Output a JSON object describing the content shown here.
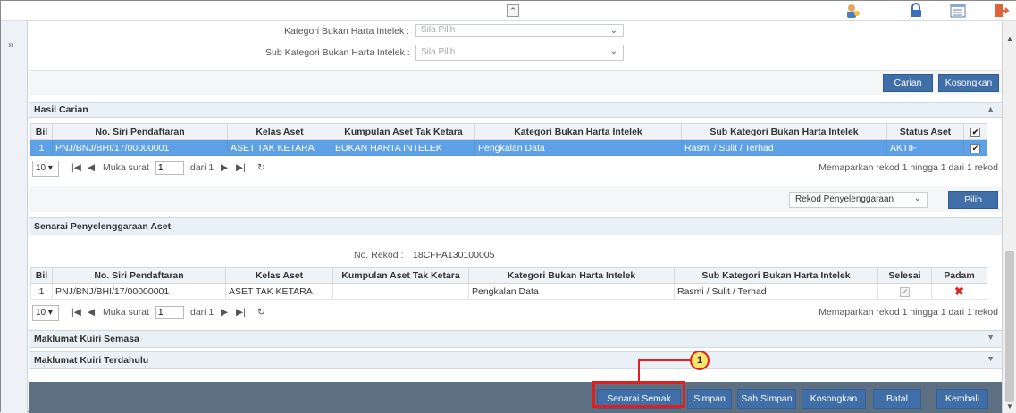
{
  "search_form": {
    "kategori_label": "Kategori Bukan Harta Intelek :",
    "kategori_placeholder": "Sila Pilih",
    "subkategori_label": "Sub Kategori Bukan Harta Intelek :",
    "subkategori_placeholder": "Sila Pilih",
    "carian_button": "Carian",
    "kosongkan_button": "Kosongkan"
  },
  "hasil_carian": {
    "title": "Hasil Carian",
    "columns": [
      "Bil",
      "No. Siri Pendaftaran",
      "Kelas Aset",
      "Kumpulan Aset Tak Ketara",
      "Kategori Bukan Harta Intelek",
      "Sub Kategori Bukan Harta Intelek",
      "Status Aset"
    ],
    "rows": [
      {
        "bil": "1",
        "no_siri": "PNJ/BNJ/BHI/17/00000001",
        "kelas": "ASET TAK KETARA",
        "kumpulan": "BUKAN HARTA INTELEK",
        "kategori": "Pengkalan Data",
        "subkategori": "Rasmi / Sulit / Terhad",
        "status": "AKTIF",
        "checked": true
      }
    ],
    "pager": {
      "page_size": "10",
      "muka_surat": "Muka surat",
      "current_page": "1",
      "dari": "dari 1",
      "summary": "Memaparkan rekod 1 hingga 1 dari 1 rekod"
    },
    "action_select": "Rekod Penyelenggaraan",
    "pilih_button": "Pilih"
  },
  "senarai": {
    "title": "Senarai Penyelenggaraan Aset",
    "no_rekod_label": "No. Rekod :",
    "no_rekod_value": "18CFPA130100005",
    "columns": [
      "Bil",
      "No. Siri Pendaftaran",
      "Kelas Aset",
      "Kumpulan Aset Tak Ketara",
      "Kategori Bukan Harta Intelek",
      "Sub Kategori Bukan Harta Intelek",
      "Selesai",
      "Padam"
    ],
    "rows": [
      {
        "bil": "1",
        "no_siri": "PNJ/BNJ/BHI/17/00000001",
        "kelas": "ASET TAK KETARA",
        "kumpulan": "",
        "kategori": "Pengkalan Data",
        "subkategori": "Rasmi / Sulit / Terhad",
        "selesai": true
      }
    ],
    "pager": {
      "page_size": "10",
      "muka_surat": "Muka surat",
      "current_page": "1",
      "dari": "dari 1",
      "summary": "Memaparkan rekod 1 hingga 1 dari 1 rekod"
    }
  },
  "kuiri_semasa": "Maklumat Kuiri Semasa",
  "kuiri_terdahulu": "Maklumat Kuiri Terdahulu",
  "footer_buttons": {
    "senarai_semak": "Senarai Semak",
    "simpan": "Simpan",
    "sah_simpan": "Sah Simpan",
    "kosongkan": "Kosongkan",
    "batal": "Batal",
    "kembali": "Kembali"
  },
  "callout_number": "1",
  "colors": {
    "accent": "#3f6ea8",
    "selected_row": "#5fa1e6",
    "highlight": "#e02020",
    "footer": "#5d6f82"
  }
}
